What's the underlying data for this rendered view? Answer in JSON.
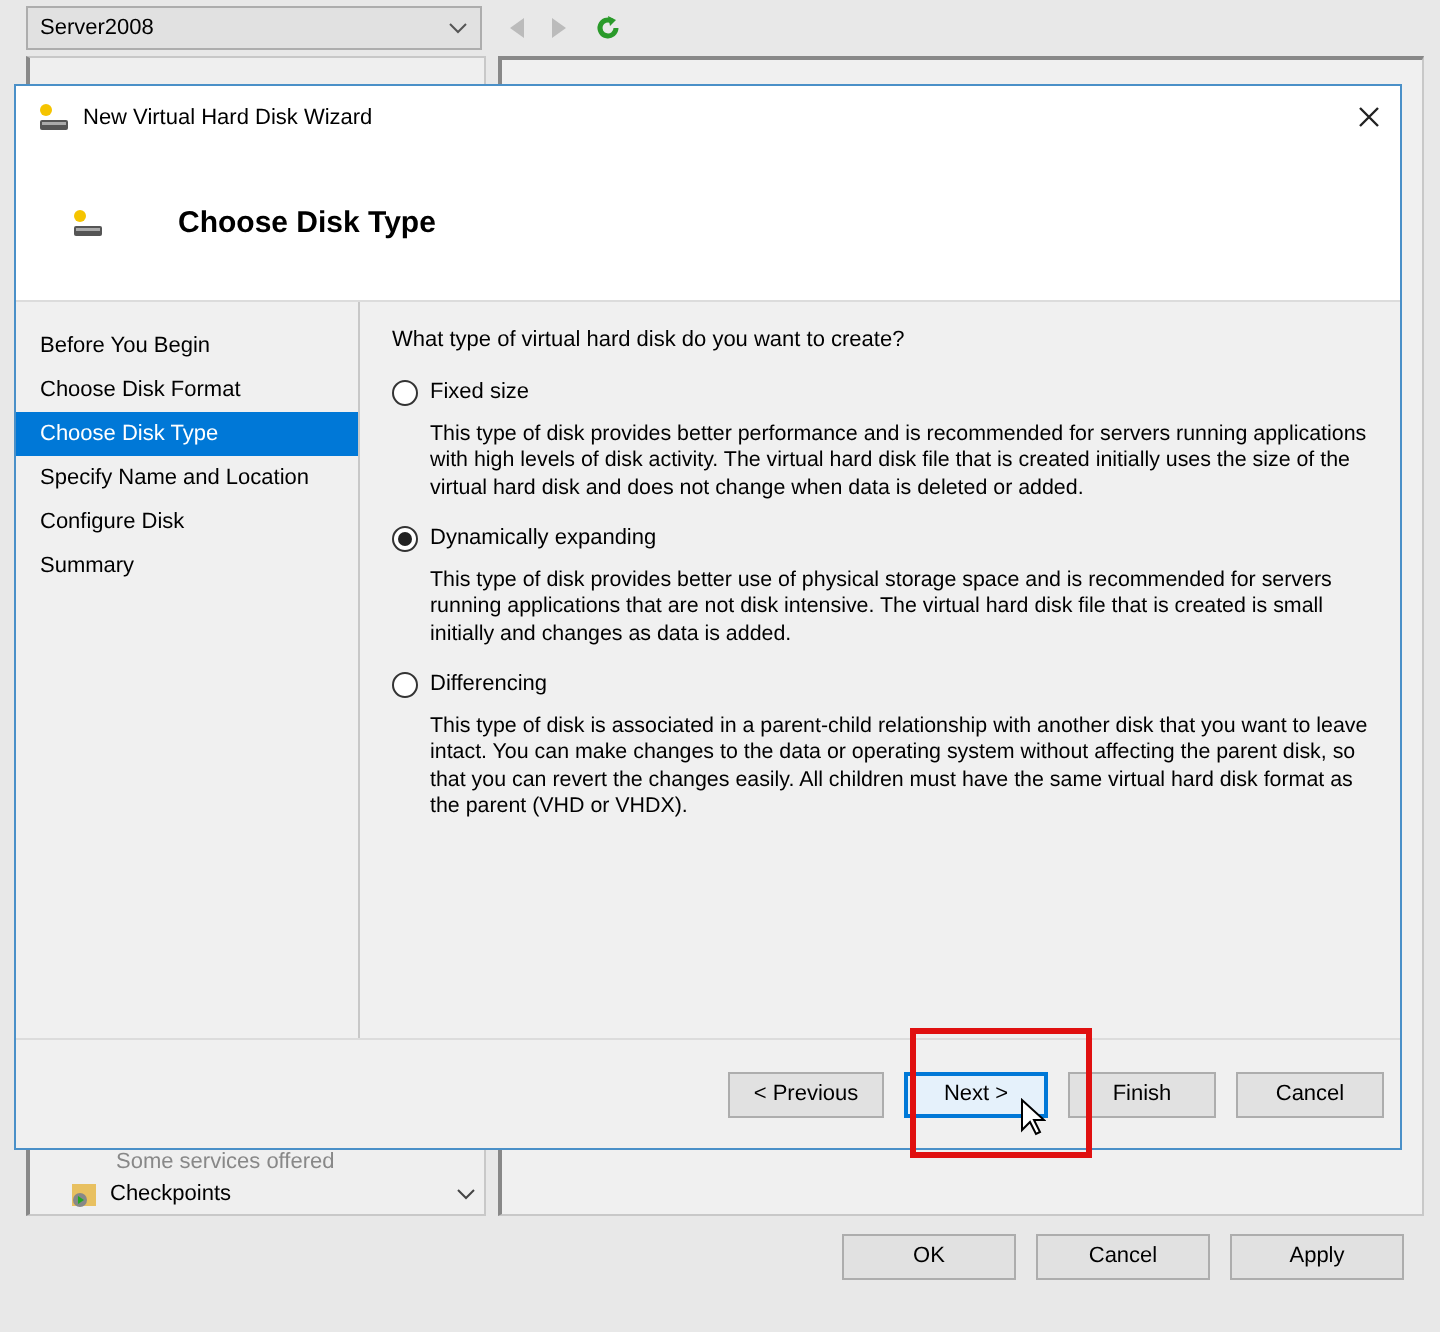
{
  "host": {
    "vm_selector": "Server2008",
    "checkpoints_item": {
      "subtitle": "Some services offered",
      "label": "Checkpoints"
    },
    "buttons": [
      "OK",
      "Cancel",
      "Apply"
    ]
  },
  "wizard": {
    "title": "New Virtual Hard Disk Wizard",
    "heading": "Choose Disk Type",
    "steps": [
      {
        "label": "Before You Begin",
        "selected": false
      },
      {
        "label": "Choose Disk Format",
        "selected": false
      },
      {
        "label": "Choose Disk Type",
        "selected": true
      },
      {
        "label": "Specify Name and Location",
        "selected": false
      },
      {
        "label": "Configure Disk",
        "selected": false
      },
      {
        "label": "Summary",
        "selected": false
      }
    ],
    "question": "What type of virtual hard disk do you want to create?",
    "options": [
      {
        "label": "Fixed size",
        "selected": false,
        "description": "This type of disk provides better performance and is recommended for servers running applications with high levels of disk activity. The virtual hard disk file that is created initially uses the size of the virtual hard disk and does not change when data is deleted or added."
      },
      {
        "label": "Dynamically expanding",
        "selected": true,
        "description": "This type of disk provides better use of physical storage space and is recommended for servers running applications that are not disk intensive. The virtual hard disk file that is created is small initially and changes as data is added."
      },
      {
        "label": "Differencing",
        "selected": false,
        "description": "This type of disk is associated in a parent-child relationship with another disk that you want to leave intact. You can make changes to the data or operating system without affecting the parent disk, so that you can revert the changes easily. All children must have the same virtual hard disk format as the parent (VHD or VHDX)."
      }
    ],
    "buttons": [
      {
        "label": "< Previous",
        "focused": false
      },
      {
        "label": "Next >",
        "focused": true
      },
      {
        "label": "Finish",
        "focused": false
      },
      {
        "label": "Cancel",
        "focused": false
      }
    ]
  }
}
